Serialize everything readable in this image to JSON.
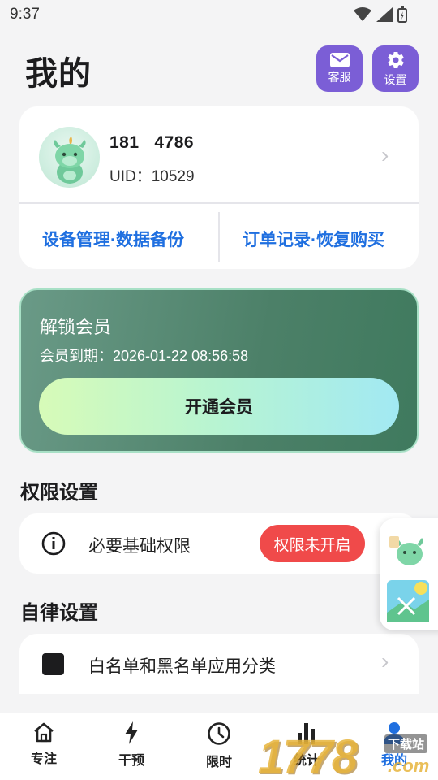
{
  "status_bar": {
    "time": "9:37"
  },
  "header": {
    "title": "我的",
    "service_label": "客服",
    "settings_label": "设置"
  },
  "profile": {
    "phone": "181    4786",
    "uid": "UID：10529",
    "link_devices": "设备管理·数据备份",
    "link_orders": "订单记录·恢复购买"
  },
  "vip": {
    "title": "解锁会员",
    "expire": "会员到期：2026-01-22 08:56:58",
    "button": "开通会员"
  },
  "permissions": {
    "section_title": "权限设置",
    "row_label": "必要基础权限",
    "badge": "权限未开启"
  },
  "discipline": {
    "section_title": "自律设置",
    "row_label": "白名单和黑名单应用分类"
  },
  "tabs": [
    {
      "label": "专注",
      "icon": "home-icon"
    },
    {
      "label": "干预",
      "icon": "lightning-icon"
    },
    {
      "label": "限时",
      "icon": "clock-icon"
    },
    {
      "label": "统计",
      "icon": "bar-chart-icon"
    },
    {
      "label": "我的",
      "icon": "user-icon",
      "active": true
    }
  ],
  "watermark": {
    "text": "1778",
    "small": "下载站",
    "suffix": ".com"
  },
  "colors": {
    "accent_purple": "#7b5ed6",
    "link_blue": "#1f6fe0",
    "vip_green": "#4c8068",
    "badge_red": "#f04a4a"
  }
}
